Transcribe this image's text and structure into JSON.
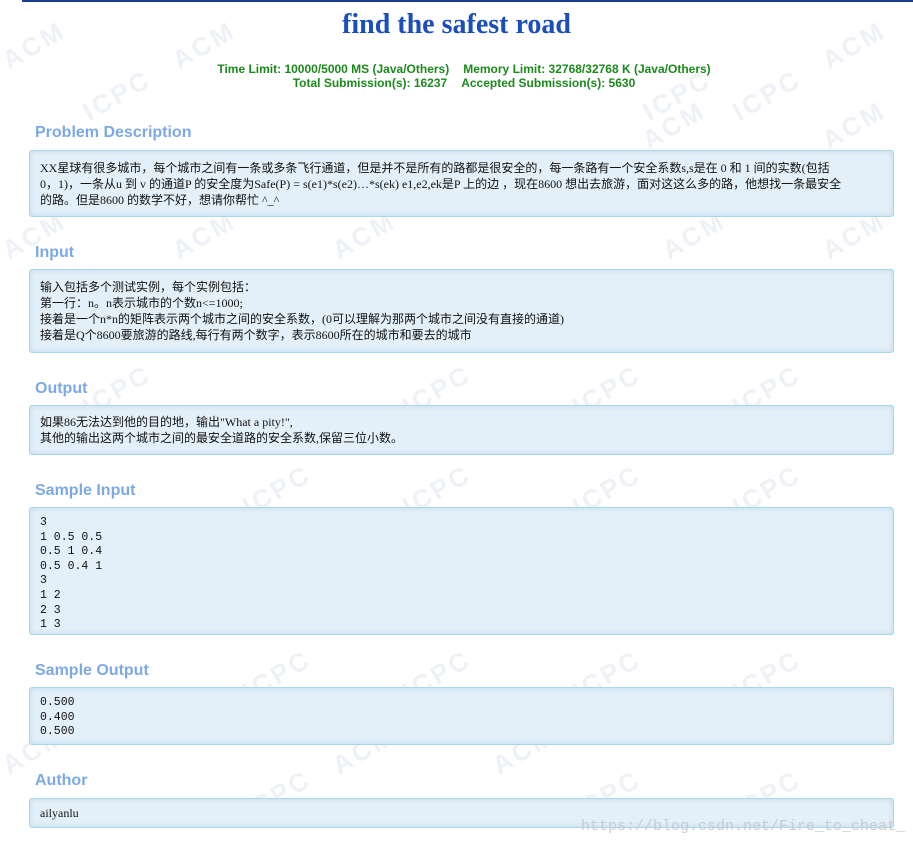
{
  "problem": {
    "title": "find the safest road",
    "time_limit": "Time Limit: 10000/5000 MS (Java/Others)",
    "memory_limit": "Memory Limit: 32768/32768 K (Java/Others)",
    "total_submissions": "Total Submission(s): 16237",
    "accepted_submissions": "Accepted Submission(s): 5630"
  },
  "sections": {
    "description": {
      "heading": "Problem Description",
      "lines": [
        "XX星球有很多城市，每个城市之间有一条或多条飞行通道，但是并不是所有的路都是很安全的，每一条路有一个安全系数s,s是在 0 和 1 间的实数(包括",
        "0，1)，一条从u 到 v 的通道P 的安全度为Safe(P) = s(e1)*s(e2)…*s(ek) e1,e2,ek是P 上的边 ，现在8600 想出去旅游，面对这这么多的路，他想找一条最安全",
        "的路。但是8600 的数学不好，想请你帮忙 ^_^"
      ]
    },
    "input": {
      "heading": "Input",
      "lines": [
        "输入包括多个测试实例，每个实例包括：",
        "第一行：n。n表示城市的个数n<=1000;",
        "接着是一个n*n的矩阵表示两个城市之间的安全系数，(0可以理解为那两个城市之间没有直接的通道)",
        "接着是Q个8600要旅游的路线,每行有两个数字，表示8600所在的城市和要去的城市"
      ]
    },
    "output": {
      "heading": "Output",
      "lines": [
        "如果86无法达到他的目的地，输出\"What a pity!\",",
        "其他的输出这两个城市之间的最安全道路的安全系数,保留三位小数。"
      ]
    },
    "sample_input": {
      "heading": "Sample Input",
      "lines": [
        "3",
        "1 0.5 0.5",
        "0.5 1 0.4",
        "0.5 0.4 1",
        "3",
        "1 2",
        "2 3",
        "1 3"
      ]
    },
    "sample_output": {
      "heading": "Sample Output",
      "lines": [
        "0.500",
        "0.400",
        "0.500"
      ]
    },
    "author": {
      "heading": "Author",
      "lines": [
        "ailyanlu"
      ]
    }
  },
  "watermark": {
    "blog_url": "https://blog.csdn.net/Fire_to_cheat_",
    "background_text": [
      "ACM",
      "ICPC"
    ]
  },
  "colors": {
    "title": "#1a4ebd",
    "limits": "#1b8a1b",
    "section_heading": "#7ca9e6",
    "panel_bg": "#e4f0f9",
    "panel_border": "#a9d7ee"
  }
}
